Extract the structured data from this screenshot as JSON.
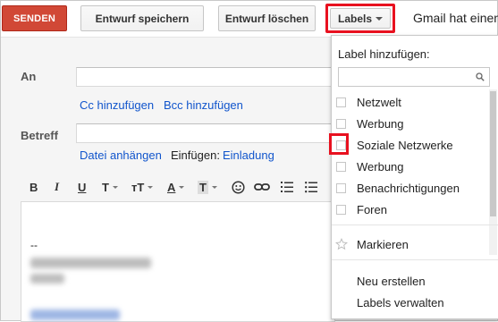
{
  "toolbar": {
    "send_label": "SENDEN",
    "save_draft_label": "Entwurf speichern",
    "discard_draft_label": "Entwurf löschen",
    "labels_label": "Labels",
    "window_title": "Gmail hat einen"
  },
  "compose": {
    "to_label": "An",
    "cc_link": "Cc hinzufügen",
    "bcc_link": "Bcc hinzufügen",
    "subject_label": "Betreff",
    "attach_link": "Datei anhängen",
    "insert_label": "Einfügen:",
    "invitation_link": "Einladung",
    "signature_dashes": "--"
  },
  "format_bar": {
    "bold": "B",
    "italic": "I",
    "underline": "U",
    "font_icon": "T",
    "size_icon": "тT",
    "text_color": "A",
    "bg_color": "T"
  },
  "labels_menu": {
    "title": "Label hinzufügen:",
    "items": [
      {
        "label": "Netzwelt",
        "checked": false
      },
      {
        "label": "Werbung",
        "checked": false
      },
      {
        "label": "Soziale Netzwerke",
        "checked": false
      },
      {
        "label": "Werbung",
        "checked": false
      },
      {
        "label": "Benachrichtigungen",
        "checked": false
      },
      {
        "label": "Foren",
        "checked": false
      }
    ],
    "star_label": "Markieren",
    "create_new": "Neu erstellen",
    "manage_labels": "Labels verwalten"
  },
  "colors": {
    "send_button": "#d14836",
    "link": "#1155cc",
    "highlight": "#e8111f"
  }
}
